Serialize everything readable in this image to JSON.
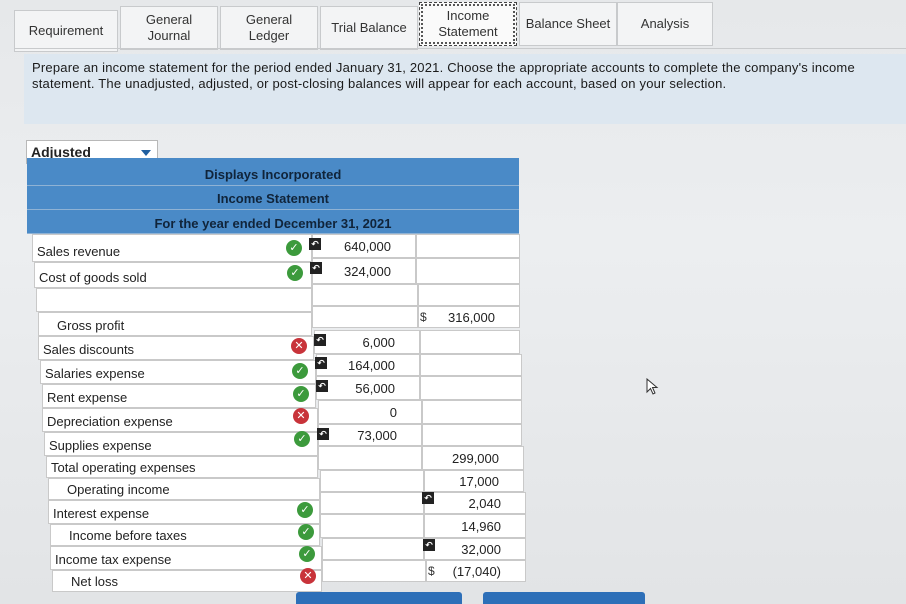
{
  "tabs": [
    {
      "label": "Requirement"
    },
    {
      "label": "General\nJournal"
    },
    {
      "label": "General\nLedger"
    },
    {
      "label": "Trial Balance"
    },
    {
      "label": "Income\nStatement"
    },
    {
      "label": "Balance Sheet"
    },
    {
      "label": "Analysis"
    }
  ],
  "instructions": "Prepare an income statement for the period ended January 31, 2021. Choose the appropriate accounts to complete the company's income statement. The unadjusted, adjusted, or post-closing balances will appear for each account, based on your selection.",
  "balance_select": {
    "value": "Adjusted"
  },
  "statement": {
    "company": "Displays Incorporated",
    "title": "Income Statement",
    "period": "For the year ended December 31, 2021"
  },
  "rows": {
    "sales_revenue": {
      "label": "Sales revenue",
      "amount": "640,000",
      "status": "check"
    },
    "cogs": {
      "label": "Cost of goods sold",
      "amount": "324,000",
      "status": "check"
    },
    "gross_profit": {
      "label": "Gross profit",
      "dollar": "$",
      "amount": "316,000"
    },
    "sales_discounts": {
      "label": "Sales discounts",
      "amount": "6,000",
      "status": "x"
    },
    "salaries": {
      "label": "Salaries expense",
      "amount": "164,000",
      "status": "check"
    },
    "rent": {
      "label": "Rent expense",
      "amount": "56,000",
      "status": "check"
    },
    "depreciation": {
      "label": "Depreciation expense",
      "amount": "0",
      "status": "x"
    },
    "supplies": {
      "label": "Supplies expense",
      "amount": "73,000",
      "status": "check"
    },
    "total_operating": {
      "label": "Total operating expenses",
      "amount": "299,000"
    },
    "operating_income": {
      "label": "Operating income",
      "amount": "17,000"
    },
    "interest": {
      "label": "Interest expense",
      "amount": "2,040",
      "status": "check"
    },
    "income_before_taxes": {
      "label": "Income before taxes",
      "amount": "14,960",
      "status": "check"
    },
    "income_tax": {
      "label": "Income tax expense",
      "amount": "32,000",
      "status": "check"
    },
    "net_loss": {
      "label": "Net loss",
      "dollar": "$",
      "amount": "(17,040)",
      "status": "x"
    }
  },
  "icons": {
    "check": "check-circle-icon",
    "x": "x-circle-icon",
    "undo": "undo-arrow-icon",
    "cursor": "mouse-pointer-icon"
  },
  "colors": {
    "header_blue": "#4a8ac7",
    "check_green": "#3c9a3c",
    "x_red": "#c8333a",
    "button_blue": "#2d6fb8"
  }
}
